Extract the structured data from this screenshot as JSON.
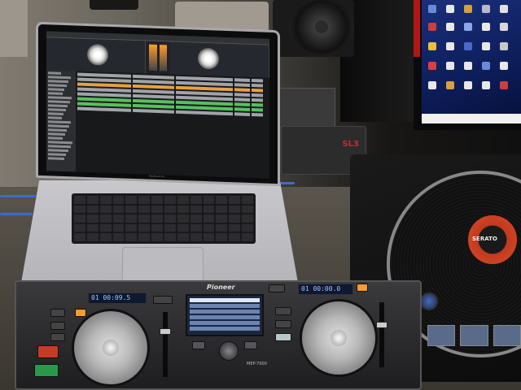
{
  "laptop": {
    "brand": "MacBook Pro"
  },
  "audio_interface": {
    "label": "SL3"
  },
  "controller": {
    "brand": "Pioneer",
    "model": "MEP-7000",
    "left_display": "01  00:09.5",
    "right_display": "01  00:00.0"
  },
  "record_label": {
    "text": "SERATO"
  },
  "colors": {
    "accent_orange": "#ff9b2a",
    "cable_blue": "#3a6ad8",
    "desktop_blue": "#1b2f7a",
    "button_red": "#c83a24",
    "button_green": "#2a9a4a"
  }
}
